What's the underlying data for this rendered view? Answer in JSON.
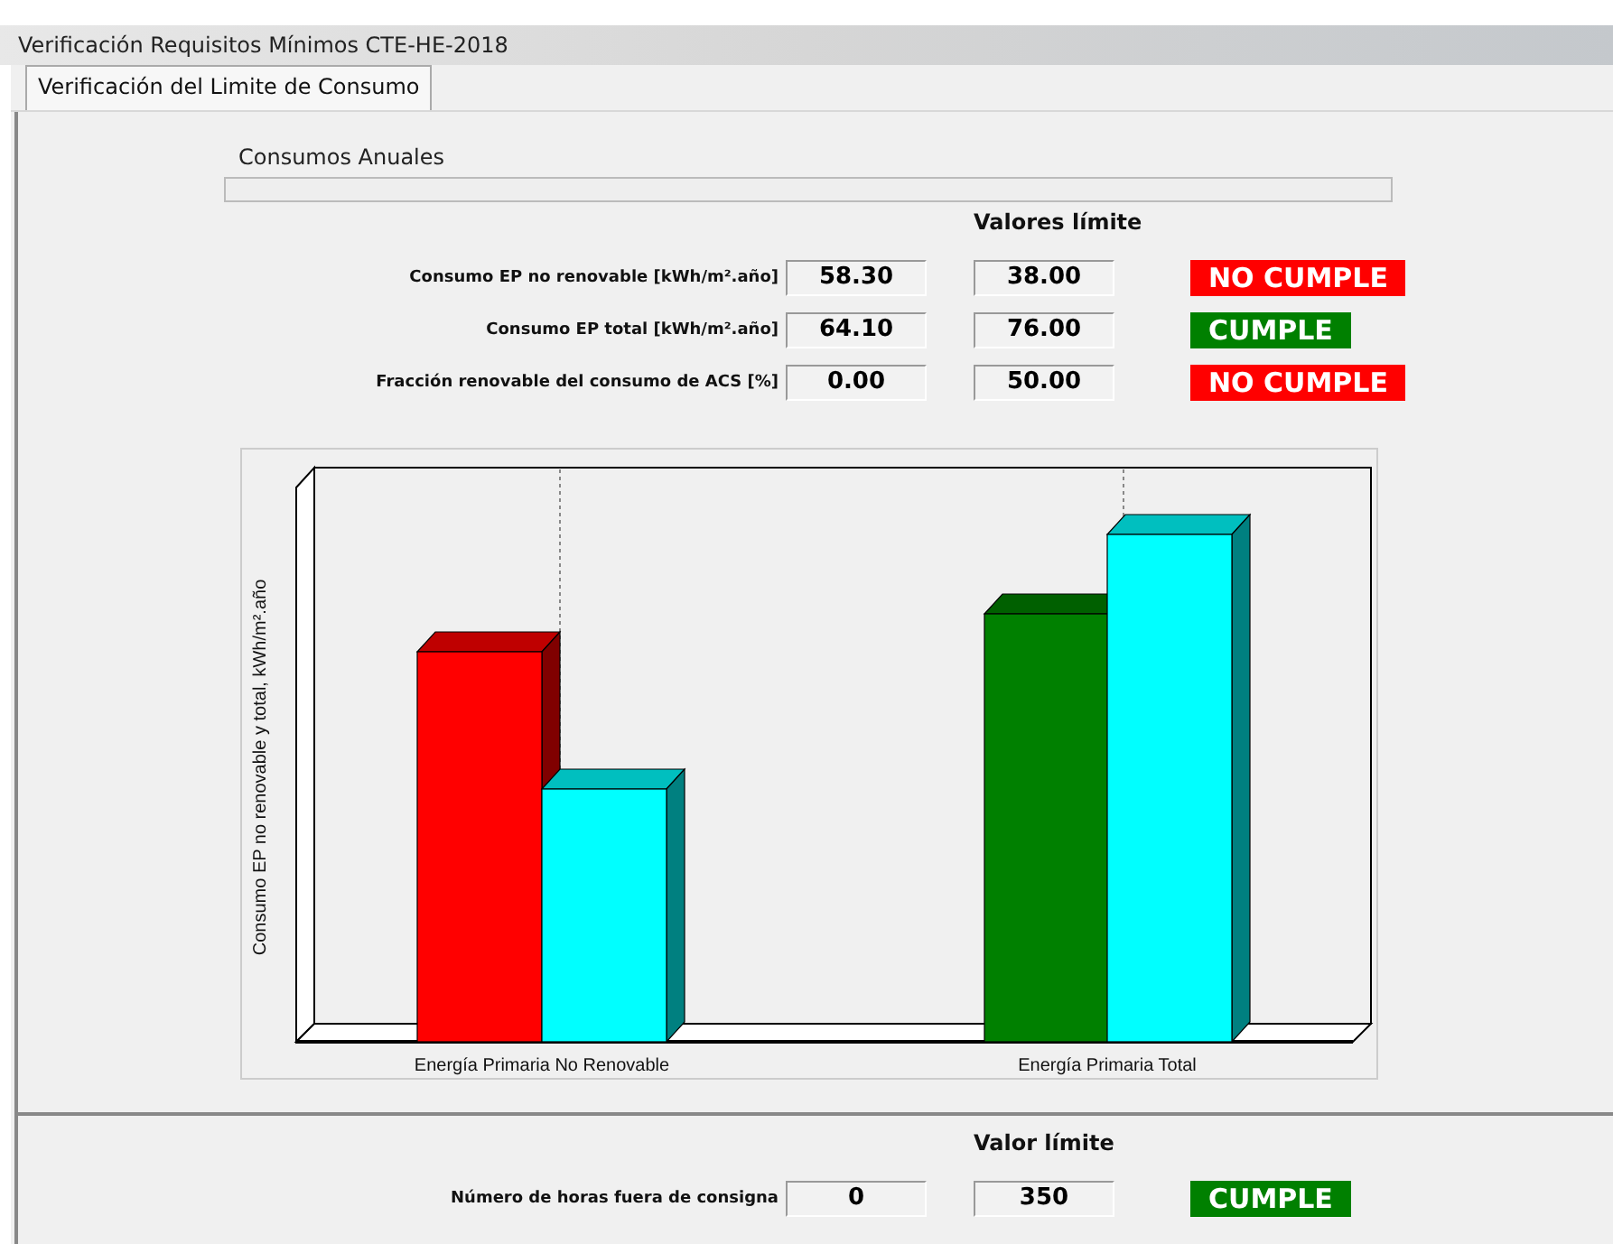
{
  "window": {
    "title": "Verificación Requisitos Mínimos CTE-HE-2018"
  },
  "tabs": [
    {
      "label": "Verificación del Limite de Consumo",
      "selected": true
    }
  ],
  "annual": {
    "title": "Consumos Anuales",
    "limit_heading": "Valores límite",
    "rows": [
      {
        "label": "Consumo EP no renovable [kWh/m².año]",
        "value": "58.30",
        "limit": "38.00",
        "status": "NO CUMPLE",
        "compliant": false
      },
      {
        "label": "Consumo EP total [kWh/m².año]",
        "value": "64.10",
        "limit": "76.00",
        "status": "CUMPLE",
        "compliant": true
      },
      {
        "label": "Fracción renovable del consumo de ACS [%]",
        "value": "0.00",
        "limit": "50.00",
        "status": "NO CUMPLE",
        "compliant": false
      }
    ]
  },
  "chart": {
    "ylabel": "Consumo EP no renovable y total, kWh/m².año",
    "categories": [
      {
        "label": "Energía Primaria No Renovable",
        "bars": [
          {
            "color": "#ff0000"
          },
          {
            "color": "#00ffff"
          }
        ]
      },
      {
        "label": "Energía Primaria Total",
        "bars": [
          {
            "color": "#008000"
          },
          {
            "color": "#00ffff"
          }
        ]
      }
    ]
  },
  "hours": {
    "limit_heading": "Valor límite",
    "rows": [
      {
        "label": "Número de horas fuera de consigna",
        "value": "0",
        "limit": "350",
        "status": "CUMPLE",
        "compliant": true
      }
    ]
  }
}
